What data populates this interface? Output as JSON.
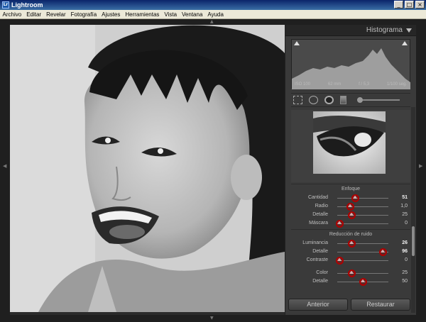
{
  "window": {
    "title": "Lightroom",
    "icon_text": "Lr",
    "minimize": "_",
    "maximize": "□",
    "close": "×"
  },
  "menu": [
    "Archivo",
    "Editar",
    "Revelar",
    "Fotografía",
    "Ajustes",
    "Herramientas",
    "Vista",
    "Ventana",
    "Ayuda"
  ],
  "histogram": {
    "title": "Histograma",
    "iso": "ISO 100",
    "focal": "62 mm",
    "aperture": "f / 5,3",
    "shutter": "1/100 seg."
  },
  "sharpening": {
    "title": "Enfoque",
    "sliders": [
      {
        "label": "Cantidad",
        "value": "51",
        "fraction": 0.34,
        "highlight": true,
        "bright": true
      },
      {
        "label": "Radio",
        "value": "1,0",
        "fraction": 0.22,
        "highlight": true,
        "bright": false
      },
      {
        "label": "Detalle",
        "value": "25",
        "fraction": 0.25,
        "highlight": true,
        "bright": false
      },
      {
        "label": "Máscara",
        "value": "0",
        "fraction": 0.0,
        "highlight": true,
        "bright": false
      }
    ]
  },
  "noise_reduction": {
    "title": "Reducción de ruido",
    "sliders": [
      {
        "label": "Luminancia",
        "value": "26",
        "fraction": 0.26,
        "highlight": true,
        "bright": true
      },
      {
        "label": "Detalle",
        "value": "96",
        "fraction": 0.92,
        "highlight": true,
        "bright": true
      },
      {
        "label": "Contraste",
        "value": "0",
        "fraction": 0.0,
        "highlight": true,
        "bright": false
      },
      {
        "label": "Color",
        "value": "25",
        "fraction": 0.25,
        "highlight": true,
        "bright": false
      },
      {
        "label": "Detalle",
        "value": "50",
        "fraction": 0.5,
        "highlight": true,
        "bright": false
      }
    ]
  },
  "buttons": {
    "previous": "Anterior",
    "reset": "Restaurar"
  },
  "colors": {
    "highlight_ring": "#b00000",
    "panel_bg": "#3a3a3a"
  }
}
